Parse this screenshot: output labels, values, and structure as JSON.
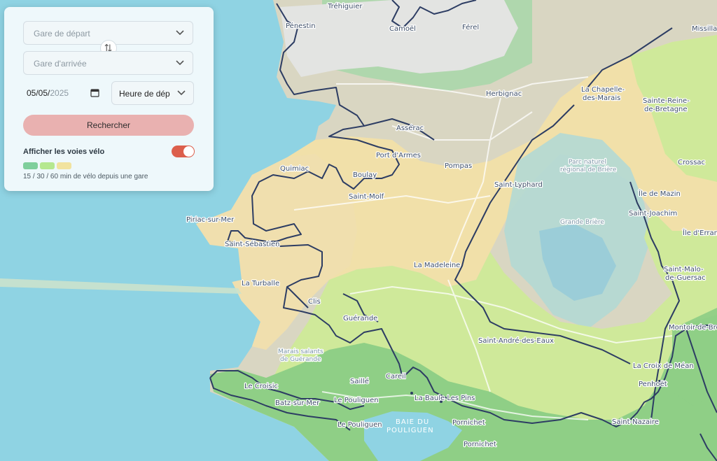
{
  "form": {
    "departure_placeholder": "Gare de départ",
    "arrival_placeholder": "Gare d'arrivée",
    "date_value": "05/05/",
    "date_year": "2025",
    "time_placeholder": "Heure de dép",
    "search_label": "Rechercher",
    "bike_toggle_label": "Afficher les voies vélo",
    "bike_toggle_on": true,
    "legend_text": "15 / 30 / 60 min de vélo depuis une gare",
    "legend_colors": [
      "#7fcf9c",
      "#b5e88f",
      "#f1e39f"
    ]
  },
  "colors": {
    "sea": "#8fd3e3",
    "accent": "#dc5f4c",
    "button": "#e9b1b0",
    "route_line": "#2d3d63"
  },
  "map": {
    "places": {
      "trehiguier": "Tréhiguier",
      "penestin": "Pénestin",
      "camoel": "Camoël",
      "ferel": "Férel",
      "missillac": "Missillac",
      "herbignac": "Herbignac",
      "chapelle1": "La Chapelle-",
      "chapelle2": "des-Marais",
      "reine1": "Sainte-Reine-",
      "reine2": "de-Bretagne",
      "asserac": "Assérac",
      "port_armes": "Port d'Armes",
      "pompas": "Pompas",
      "crossac": "Crossac",
      "quimiac": "Quimiac",
      "boulay": "Boulay",
      "saint_lyphard": "Saint-Lyphard",
      "ile_mazin": "Île de Mazin",
      "saint_molf": "Saint-Molf",
      "saint_joachim": "Saint-Joachim",
      "piriac": "Piriac-sur-Mer",
      "ile_errand": "Île d'Errand",
      "saint_sebastien": "Saint-Sébastien",
      "la_madeleine": "La Madeleine",
      "malo1": "Saint-Malo-",
      "malo2": "de-Guersac",
      "la_turballe": "La Turballe",
      "clis": "Clis",
      "guerande": "Guérande",
      "montoir": "Montoir-de-Bre",
      "andre_eaux": "Saint-André-des-Eaux",
      "croix_mean": "La Croix de Méan",
      "le_croisic": "Le Croisic",
      "saille": "Saillé",
      "careil": "Careil",
      "penhoet": "Penhoët",
      "batz": "Batz-sur-Mer",
      "le_pouliguen": "Le Pouliguen",
      "baule": "La Baule Les Pins",
      "le_pouliguen2": "Le Pouliguen",
      "pornichet": "Pornichet",
      "saint_nazaire": "Saint-Nazaire",
      "pornichet2": "Pornichet"
    },
    "areas": {
      "parc1": "Parc naturel",
      "parc2": "régional de Brière",
      "grande_briere": "Grande Brière",
      "marais1": "Marais salants",
      "marais2": "de Guérande"
    },
    "water": {
      "baie1": "BAIE DU",
      "baie2": "POULIGUEN"
    }
  }
}
